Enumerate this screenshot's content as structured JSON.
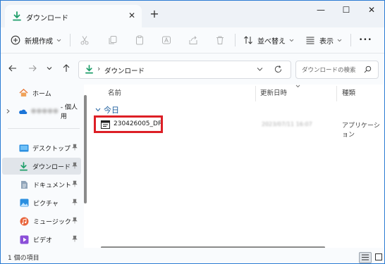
{
  "window": {
    "tab_title": "ダウンロード",
    "tab_close_glyph": "✕",
    "new_tab_glyph": "+",
    "minimize_glyph": "—",
    "maximize_glyph": "☐",
    "close_glyph": "✕",
    "border_color": "#2b7bd3"
  },
  "toolbar": {
    "new_label": "新規作成",
    "sort_label": "並べ替え",
    "view_label": "表示",
    "more_label": "•••",
    "icons": [
      "cut-icon",
      "copy-icon",
      "paste-icon",
      "rename-icon",
      "share-icon",
      "delete-icon"
    ]
  },
  "address": {
    "separator": "›",
    "location": "ダウンロード",
    "search_placeholder": "ダウンロードの検索"
  },
  "nav": {
    "items": [
      {
        "label": "ホーム",
        "icon": "home-icon"
      },
      {
        "label": "- 個人用",
        "icon": "onedrive-icon",
        "blurred_prefix": "●●●●●"
      },
      {
        "label": "デスクトップ",
        "icon": "desktop-icon"
      },
      {
        "label": "ダウンロード",
        "icon": "download-icon",
        "selected": true
      },
      {
        "label": "ドキュメント",
        "icon": "document-icon"
      },
      {
        "label": "ピクチャ",
        "icon": "pictures-icon"
      },
      {
        "label": "ミュージック",
        "icon": "music-icon"
      },
      {
        "label": "ビデオ",
        "icon": "video-icon"
      }
    ]
  },
  "list": {
    "columns": [
      "名前",
      "更新日時",
      "種類"
    ],
    "group_label": "今日",
    "rows": [
      {
        "name": "230426005_DR",
        "modified": "2023/07/11 16:07",
        "type": "アプリケーション"
      }
    ],
    "highlight_color": "#dd1f26"
  },
  "status": {
    "item_count": "1 個の項目"
  }
}
